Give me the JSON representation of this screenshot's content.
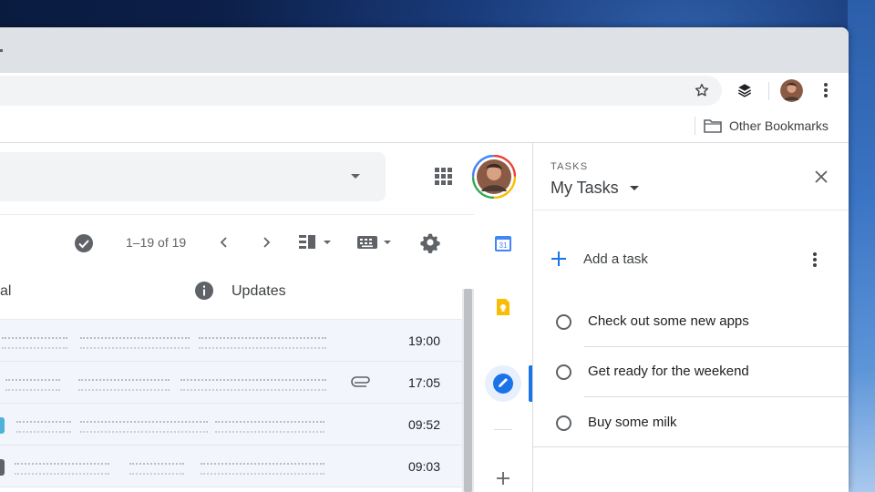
{
  "bookmarks": {
    "other_label": "Other Bookmarks"
  },
  "mail_toolbar": {
    "pager_text": "1–19 of 19"
  },
  "inbox_tabs": {
    "left_partial": "al",
    "updates": "Updates"
  },
  "mail_rows": [
    {
      "time": "19:00",
      "has_attachment": false,
      "label_color": ""
    },
    {
      "time": "17:05",
      "has_attachment": true,
      "label_color": ""
    },
    {
      "time": "09:52",
      "has_attachment": false,
      "label_color": "#4fb3d9"
    },
    {
      "time": "09:03",
      "has_attachment": false,
      "label_color": "#5f6368"
    }
  ],
  "side_rail": {
    "calendar_day": "31"
  },
  "tasks": {
    "eyebrow": "TASKS",
    "list_name": "My Tasks",
    "add_label": "Add a task",
    "items": [
      {
        "title": "Check out some new apps"
      },
      {
        "title": "Get ready for the weekend"
      },
      {
        "title": "Buy some milk"
      }
    ]
  },
  "colors": {
    "accent": "#1a73e8",
    "calendar_blue": "#4285f4",
    "keep_yellow": "#fbbc04",
    "row_background": "#f2f6fc"
  }
}
